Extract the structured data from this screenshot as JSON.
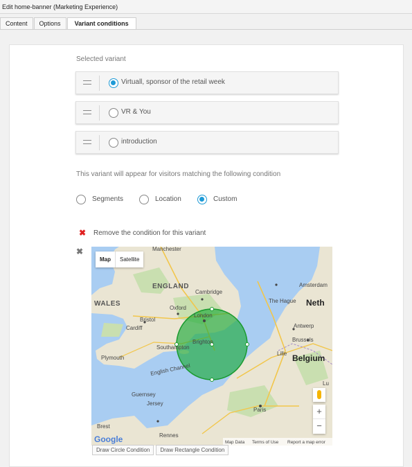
{
  "window": {
    "title": "Edit home-banner (Marketing Experience)"
  },
  "tabs": [
    {
      "label": "Content",
      "active": false
    },
    {
      "label": "Options",
      "active": false
    },
    {
      "label": "Variant conditions",
      "active": true
    }
  ],
  "variants": {
    "heading": "Selected variant",
    "items": [
      {
        "label": "Virtuall, sponsor of the retail week",
        "selected": true
      },
      {
        "label": "VR & You",
        "selected": false
      },
      {
        "label": "introduction",
        "selected": false
      }
    ]
  },
  "condition": {
    "description": "This variant will appear for visitors matching the following condition",
    "options": [
      {
        "label": "Segments",
        "selected": false
      },
      {
        "label": "Location",
        "selected": false
      },
      {
        "label": "Custom",
        "selected": true
      }
    ],
    "remove_label": "Remove the condition for this variant"
  },
  "map": {
    "type_map": "Map",
    "type_satellite": "Satellite",
    "places": {
      "manchester": "Manchester",
      "england": "ENGLAND",
      "wales": "WALES",
      "cambridge": "Cambridge",
      "oxford": "Oxford",
      "london": "London",
      "bristol": "Bristol",
      "cardiff": "Cardiff",
      "southampton": "Southampton",
      "brighton": "Brighton",
      "plymouth": "Plymouth",
      "english_channel": "English Channel",
      "guernsey": "Guernsey",
      "jersey": "Jersey",
      "amsterdam": "Amsterdam",
      "the_hague": "The Hague",
      "netherlands": "Neth",
      "antwerp": "Antwerp",
      "brussels": "Brussels",
      "lille": "Lille",
      "belgium": "Belgium",
      "luxembourg": "Lu",
      "paris": "Paris",
      "brest": "Brest",
      "rennes": "Rennes"
    },
    "footer": {
      "logo": "Google",
      "data": "Map Data",
      "terms": "Terms of Use",
      "report": "Report a map error"
    },
    "zoom_in": "+",
    "zoom_out": "−",
    "circle_color": "#1faa3a"
  },
  "buttons": {
    "draw_circle": "Draw Circle Condition",
    "draw_rect": "Draw Rectangle Condition"
  },
  "colors": {
    "accent": "#1e9ad6",
    "remove": "#e02020"
  }
}
